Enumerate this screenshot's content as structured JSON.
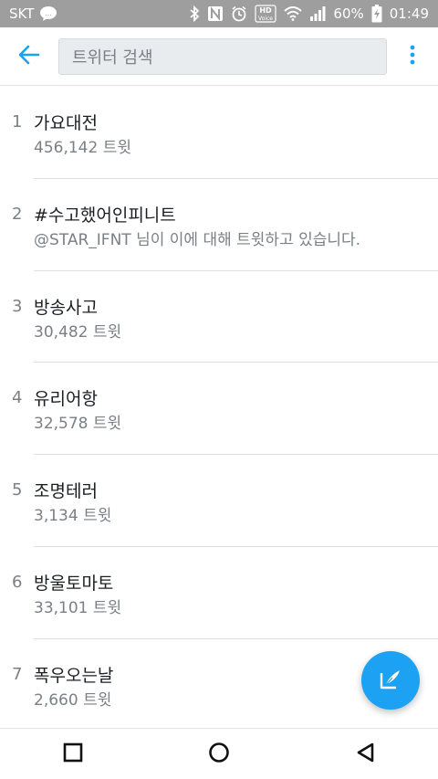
{
  "status_bar": {
    "carrier": "SKT",
    "battery_percent": "60%",
    "time": "01:49",
    "hd_label_top": "HD",
    "hd_label_bottom": "Voice"
  },
  "app_bar": {
    "search_placeholder": "트위터 검색"
  },
  "trends": [
    {
      "rank": "1",
      "title": "가요대전",
      "subtitle": "456,142 트윗"
    },
    {
      "rank": "2",
      "title": "#수고했어인피니트",
      "subtitle": "@STAR_IFNT 님이 이에 대해 트윗하고 있습니다."
    },
    {
      "rank": "3",
      "title": "방송사고",
      "subtitle": "30,482 트윗"
    },
    {
      "rank": "4",
      "title": "유리어항",
      "subtitle": "32,578 트윗"
    },
    {
      "rank": "5",
      "title": "조명테러",
      "subtitle": "3,134 트윗"
    },
    {
      "rank": "6",
      "title": "방울토마토",
      "subtitle": "33,101 트윗"
    },
    {
      "rank": "7",
      "title": "폭우오는날",
      "subtitle": "2,660 트윗"
    }
  ],
  "colors": {
    "accent": "#1da1f2",
    "status_bar_bg": "#9e9e9e",
    "secondary_text": "#7a8086"
  },
  "icons": {
    "back": "arrow-left-icon",
    "more": "overflow-menu-icon",
    "compose": "compose-tweet-icon",
    "nav_recent": "square-icon",
    "nav_home": "circle-icon",
    "nav_back": "triangle-back-icon"
  }
}
